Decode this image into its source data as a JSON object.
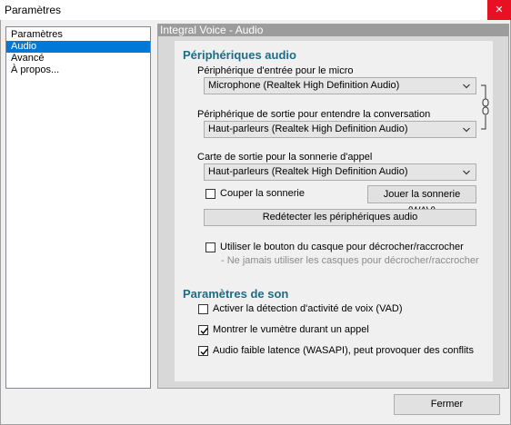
{
  "window": {
    "title": "Paramètres",
    "close_glyph": "✕"
  },
  "nav": {
    "items": [
      {
        "label": "Paramètres"
      },
      {
        "label": "Audio"
      },
      {
        "label": "Avancé"
      },
      {
        "label": "À propos..."
      }
    ],
    "selected": "Audio"
  },
  "panel": {
    "header": "Integral Voice - Audio",
    "audio_devices": {
      "title": "Périphériques audio",
      "input_label": "Périphérique d'entrée pour le micro",
      "input_value": "Microphone (Realtek High Definition Audio)",
      "output_label": "Périphérique de sortie pour entendre la conversation",
      "output_value": "Haut-parleurs (Realtek High Definition Audio)",
      "ring_label": "Carte de sortie pour la sonnerie d'appel",
      "ring_value": "Haut-parleurs (Realtek High Definition Audio)",
      "mute_ring_label": "Couper la sonnerie",
      "mute_ring_checked": false,
      "play_ring_button": "Jouer la sonnerie (WAV)",
      "redetect_button": "Redétecter les périphériques audio",
      "headset_button_label": "Utiliser le bouton du casque pour décrocher/raccrocher",
      "headset_button_checked": false,
      "headset_note": "- Ne jamais utiliser les casques pour décrocher/raccrocher"
    },
    "sound_settings": {
      "title": "Paramètres de son",
      "options": [
        {
          "label": "Activer la détection d'activité de voix (VAD)",
          "checked": false
        },
        {
          "label": "Montrer le vumètre durant un appel",
          "checked": true
        },
        {
          "label": "Audio faible latence (WASAPI), peut provoquer des conflits",
          "checked": true
        }
      ]
    }
  },
  "footer": {
    "close_button": "Fermer"
  },
  "icons": {
    "dropdown": "chevron-down-icon",
    "link": "chain-link-icon",
    "check": "checkmark-icon"
  }
}
